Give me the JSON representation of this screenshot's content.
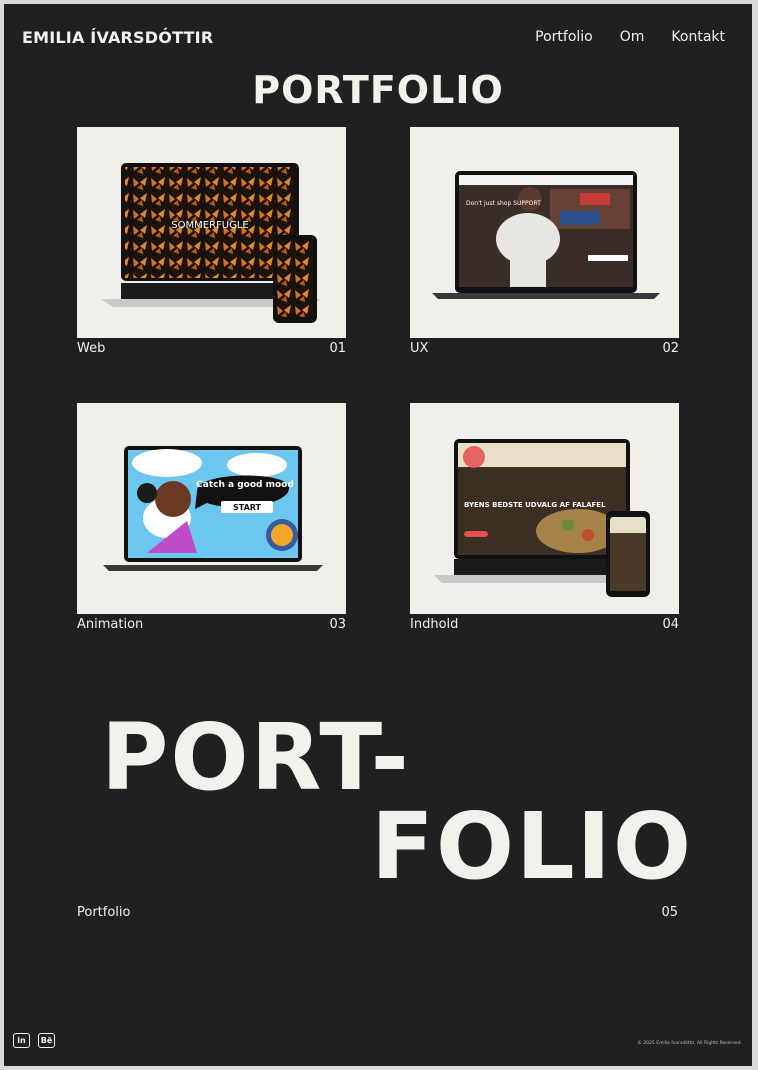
{
  "header": {
    "brand": "EMILIA ÍVARSDÓTTIR",
    "nav": [
      "Portfolio",
      "Om",
      "Kontakt"
    ]
  },
  "page_title": "PORTFOLIO",
  "projects": [
    {
      "label": "Web",
      "number": "01",
      "screen_title": "SOMMERFUGLE"
    },
    {
      "label": "UX",
      "number": "02",
      "screen_title": "Don't just shop SUPPORT"
    },
    {
      "label": "Animation",
      "number": "03",
      "screen_title": "Catch a good mood",
      "screen_button": "START"
    },
    {
      "label": "Indhold",
      "number": "04",
      "screen_title": "BYENS BEDSTE UDVALG AF FALAFEL"
    }
  ],
  "hero": {
    "line1": "PORT-",
    "line2": "FOLIO",
    "label": "Portfolio",
    "number": "05"
  },
  "footer": {
    "linkedin": "in",
    "behance": "Bē",
    "copyright": "© 2025 Emilia Ívarsdóttir. All Rights Reserved."
  },
  "colors": {
    "background": "#202020",
    "text": "#f2f1ec",
    "card": "#f0efea"
  }
}
